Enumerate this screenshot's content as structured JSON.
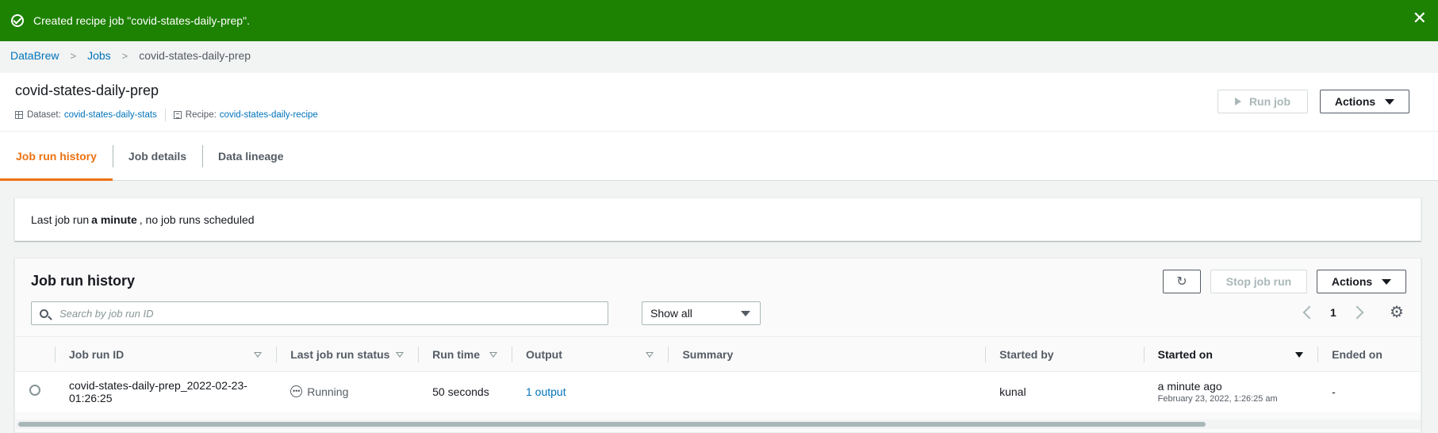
{
  "flash": {
    "message": "Created recipe job \"covid-states-daily-prep\".",
    "icon": "check-circle-icon",
    "color": "#1d8102"
  },
  "breadcrumb": {
    "items": [
      "DataBrew",
      "Jobs"
    ],
    "current": "covid-states-daily-prep"
  },
  "header": {
    "title": "covid-states-daily-prep",
    "dataset_label": "Dataset:",
    "dataset_value": "covid-states-daily-stats",
    "recipe_label": "Recipe:",
    "recipe_value": "covid-states-daily-recipe",
    "run_job_label": "Run job",
    "actions_label": "Actions"
  },
  "tabs": [
    {
      "label": "Job run history",
      "active": true
    },
    {
      "label": "Job details",
      "active": false
    },
    {
      "label": "Data lineage",
      "active": false
    }
  ],
  "last_run": {
    "prefix": "Last job run",
    "bold": "a minute",
    "suffix": ", no job runs scheduled"
  },
  "panel": {
    "title": "Job run history",
    "stop_label": "Stop job run",
    "actions_label": "Actions",
    "search_placeholder": "Search by job run ID",
    "filter_value": "Show all",
    "page": "1"
  },
  "table": {
    "columns": [
      "Job run ID",
      "Last job run status",
      "Run time",
      "Output",
      "Summary",
      "Started by",
      "Started on",
      "Ended on"
    ],
    "rows": [
      {
        "job_run_id": "covid-states-daily-prep_2022-02-23-01:26:25",
        "status": "Running",
        "run_time": "50 seconds",
        "output": "1 output",
        "summary": "",
        "started_by": "kunal",
        "started_on": "a minute ago",
        "started_on_detail": "February 23, 2022, 1:26:25 am",
        "ended_on": "-"
      }
    ]
  },
  "colors": {
    "accent": "#ec7211",
    "link": "#0073bb",
    "success": "#1d8102"
  }
}
